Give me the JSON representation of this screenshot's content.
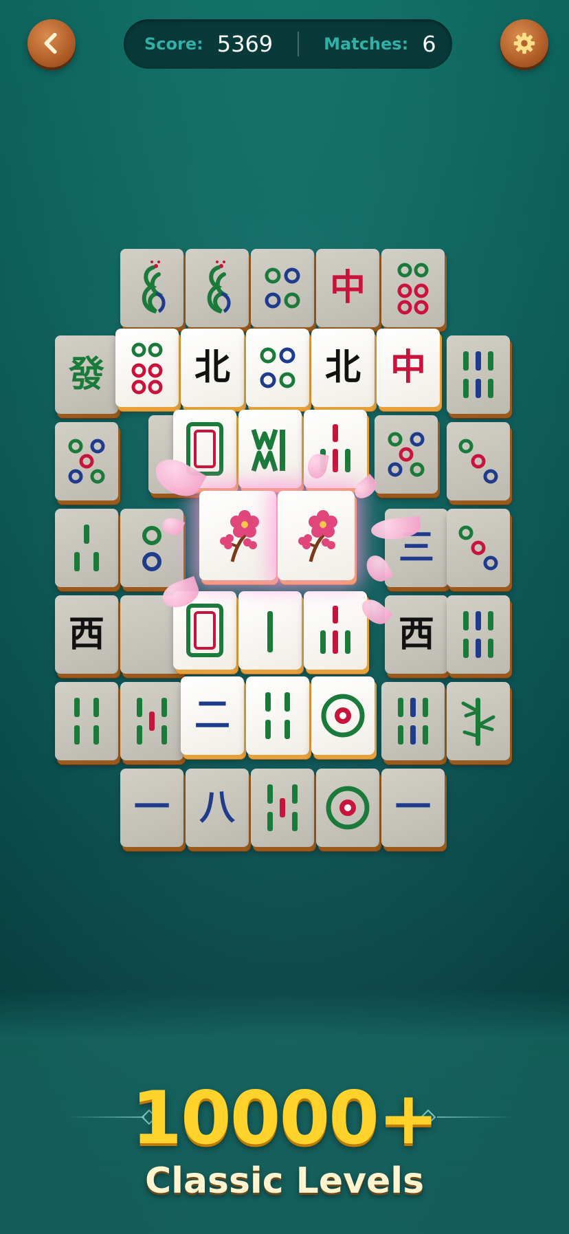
{
  "header": {
    "score_label": "Score:",
    "score_value": "5369",
    "matches_label": "Matches:",
    "matches_value": "6",
    "back_icon": "chevron-left-icon",
    "settings_icon": "gear-icon"
  },
  "tiles": {
    "r1": [
      "peacock",
      "peacock",
      "circle-4",
      "中",
      "circle-6"
    ],
    "r2": [
      "發",
      "circle-6",
      "北",
      "circle-4",
      "北",
      "中",
      "bamboo-6"
    ],
    "r3": [
      "circle-5",
      "white-dragon",
      "west-wind-green",
      "bamboo-mixed-5",
      "circle-5",
      "circle-3"
    ],
    "r4": [
      "bamboo-3",
      "circle-2",
      "plum-blossom",
      "plum-blossom",
      "三",
      "circle-3"
    ],
    "r5": [
      "西",
      "white-dragon",
      "bamboo-1",
      "bamboo-mixed-7",
      "西",
      "bamboo-6"
    ],
    "r6": [
      "bamboo-4",
      "bamboo-5",
      "二",
      "bamboo-4",
      "circle-1",
      "bamboo-6",
      "bamboo-plant"
    ],
    "r7": [
      "一",
      "八",
      "bamboo-5",
      "circle-1",
      "一"
    ]
  },
  "promo": {
    "headline": "10000+",
    "subline": "Classic Levels"
  },
  "colors": {
    "accent_teal": "#32b0a5",
    "headline_gold": "#ffd22c",
    "tile_red": "#c8143c",
    "tile_green": "#1a7a3a",
    "tile_blue": "#1f3c8c"
  }
}
